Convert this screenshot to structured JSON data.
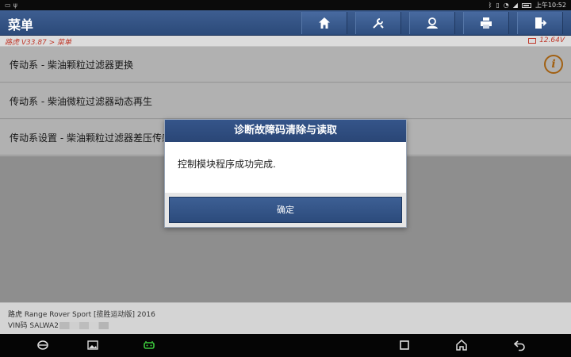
{
  "status_bar": {
    "left_glyphs": [
      "▭",
      "ψ"
    ],
    "time": "上午10:52"
  },
  "header": {
    "title": "菜单",
    "buttons": [
      {
        "name": "home-icon"
      },
      {
        "name": "tools-icon"
      },
      {
        "name": "user-support-icon"
      },
      {
        "name": "print-icon"
      },
      {
        "name": "exit-icon"
      }
    ]
  },
  "breadcrumb": {
    "path": "路虎 V33.87 > 菜单",
    "voltage": "12.64V"
  },
  "menu": {
    "items": [
      {
        "label": "传动系 - 柴油颗粒过滤器更换"
      },
      {
        "label": "传动系 - 柴油微粒过滤器动态再生"
      },
      {
        "label": "传动系设置 - 柴油颗粒过滤器差压传感器"
      }
    ],
    "info_glyph": "i"
  },
  "dialog": {
    "title": "诊断故障码清除与读取",
    "message": "控制模块程序成功完成.",
    "confirm_label": "确定"
  },
  "vehicle": {
    "model": "路虎 Range Rover Sport [揽胜运动版] 2016",
    "vin_prefix": "VIN码 SALWA2"
  },
  "nav_bar": {
    "icons": [
      "browser-icon",
      "gallery-icon",
      "vci-icon",
      "recent-apps-icon",
      "home-icon",
      "back-icon"
    ]
  },
  "colors": {
    "header_blue": "#2f4f80",
    "breadcrumb_red": "#c0392b",
    "info_orange": "#e0861a"
  }
}
